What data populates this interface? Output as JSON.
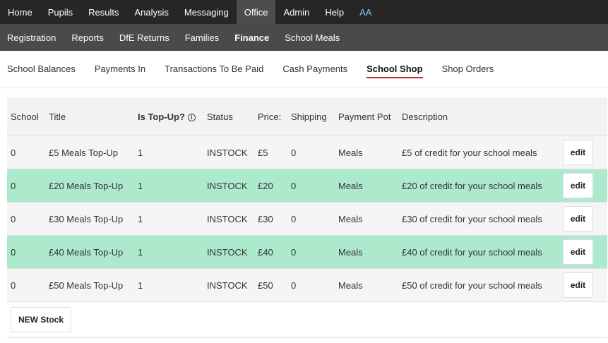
{
  "topnav": {
    "items": [
      "Home",
      "Pupils",
      "Results",
      "Analysis",
      "Messaging",
      "Office",
      "Admin",
      "Help",
      "AA"
    ],
    "active": "Office"
  },
  "subnav": {
    "items": [
      "Registration",
      "Reports",
      "DfE Returns",
      "Families",
      "Finance",
      "School Meals"
    ],
    "active": "Finance"
  },
  "tabs": {
    "items": [
      "School Balances",
      "Payments In",
      "Transactions To Be Paid",
      "Cash Payments",
      "School Shop",
      "Shop Orders"
    ],
    "active": "School Shop"
  },
  "table": {
    "headers": [
      "School",
      "Title",
      "Is Top-Up?",
      "Status",
      "Price:",
      "Shipping",
      "Payment Pot",
      "Description"
    ],
    "info_icon_glyph": "i",
    "edit_label": "edit",
    "rows": [
      [
        "0",
        "£5 Meals Top-Up",
        "1",
        "INSTOCK",
        "£5",
        "0",
        "Meals",
        "£5 of credit for your school meals"
      ],
      [
        "0",
        "£20 Meals Top-Up",
        "1",
        "INSTOCK",
        "£20",
        "0",
        "Meals",
        "£20 of credit for your school meals"
      ],
      [
        "0",
        "£30 Meals Top-Up",
        "1",
        "INSTOCK",
        "£30",
        "0",
        "Meals",
        "£30 of credit for your school meals"
      ],
      [
        "0",
        "£40 Meals Top-Up",
        "1",
        "INSTOCK",
        "£40",
        "0",
        "Meals",
        "£40 of credit for your school meals"
      ],
      [
        "0",
        "£50 Meals Top-Up",
        "1",
        "INSTOCK",
        "£50",
        "0",
        "Meals",
        "£50 of credit for your school meals"
      ]
    ]
  },
  "new_stock_label": "NEW Stock",
  "colors": {
    "topnav_bg": "#262626",
    "subnav_bg": "#4a4a4a",
    "row_highlight": "#ade9cd",
    "tab_underline": "#c0283a",
    "initials": "#7ec8f2"
  }
}
